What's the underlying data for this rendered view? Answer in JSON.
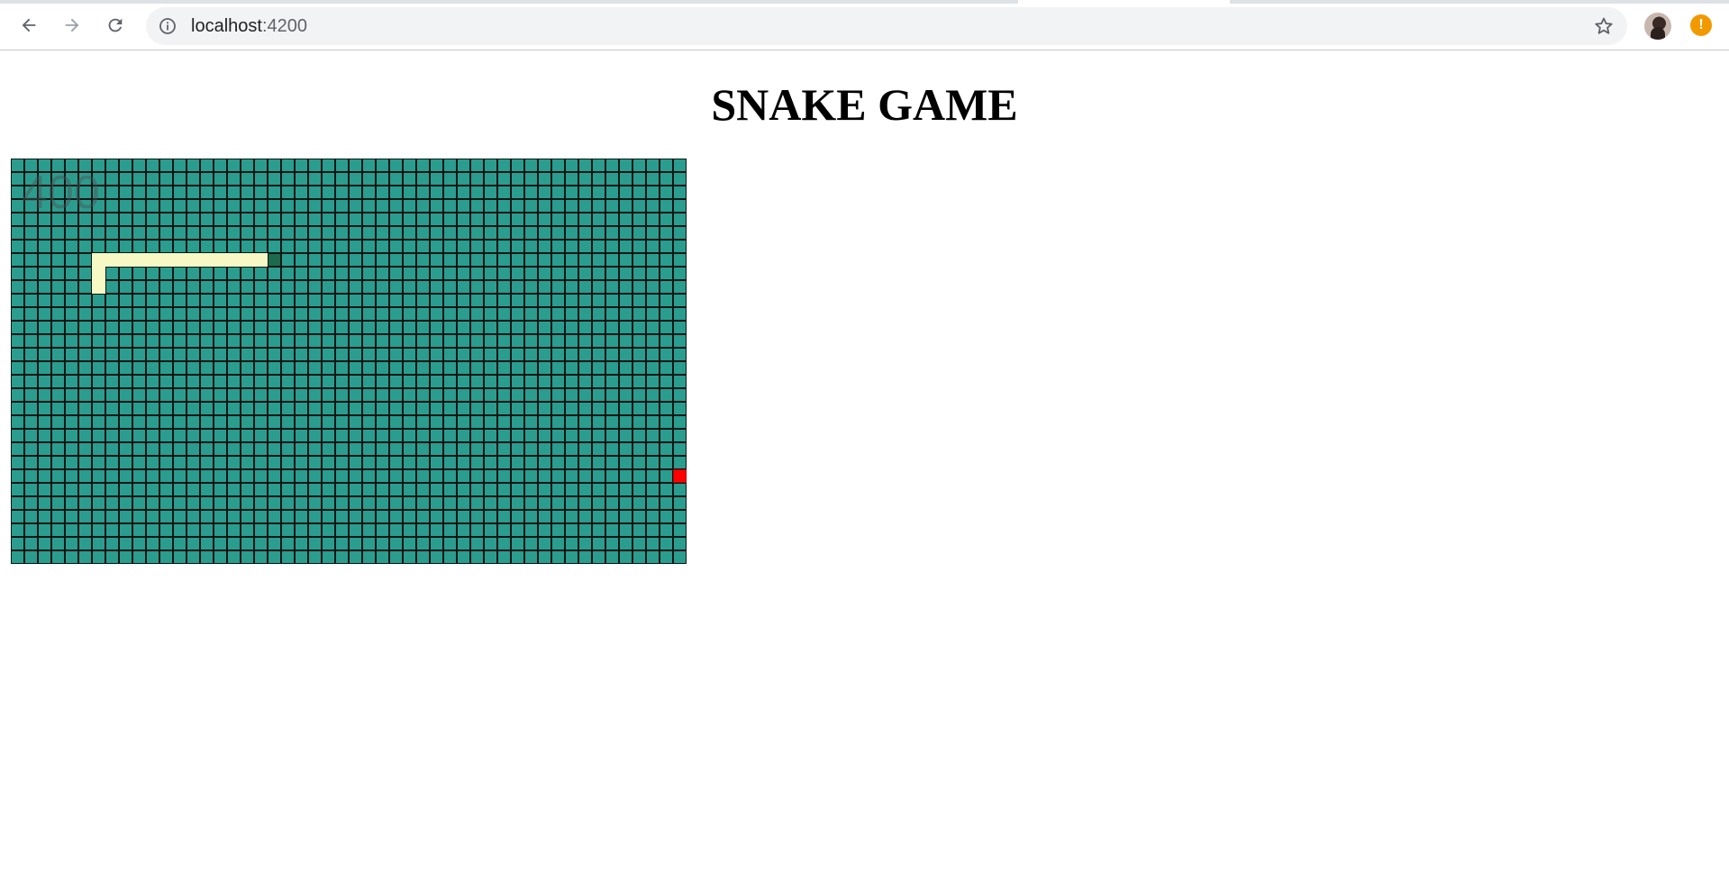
{
  "browser": {
    "url_host": "localhost",
    "url_port": ":4200",
    "back_icon": "arrow-left-icon",
    "forward_icon": "arrow-right-icon",
    "reload_icon": "reload-icon",
    "info_icon": "info-circle-icon",
    "star_icon": "star-icon",
    "alert_icon_text": "!",
    "alert_color": "#f29900"
  },
  "game": {
    "title": "SNAKE GAME",
    "score": "400",
    "grid": {
      "columns": 50,
      "rows": 30
    },
    "snake": {
      "head": [
        19,
        7
      ],
      "body": [
        [
          6,
          7
        ],
        [
          7,
          7
        ],
        [
          8,
          7
        ],
        [
          9,
          7
        ],
        [
          10,
          7
        ],
        [
          11,
          7
        ],
        [
          12,
          7
        ],
        [
          13,
          7
        ],
        [
          14,
          7
        ],
        [
          15,
          7
        ],
        [
          16,
          7
        ],
        [
          17,
          7
        ],
        [
          18,
          7
        ],
        [
          6,
          8
        ],
        [
          6,
          9
        ]
      ]
    },
    "food": [
      49,
      23
    ],
    "colors": {
      "board": "#2a9d8f",
      "snake": "#f7f9c5",
      "head": "#1c6b4d",
      "food": "#ff0000"
    }
  }
}
